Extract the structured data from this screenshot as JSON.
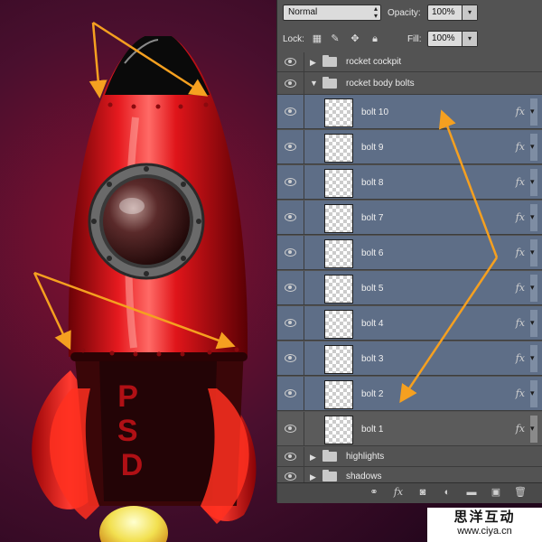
{
  "panel": {
    "blend_mode": "Normal",
    "opacity_label": "Opacity:",
    "opacity_value": "100%",
    "lock_label": "Lock:",
    "fill_label": "Fill:",
    "fill_value": "100%"
  },
  "artwork": {
    "rocket_text": "PSD"
  },
  "groups": {
    "cockpit": "rocket cockpit",
    "body_bolts": "rocket body bolts",
    "highlights": "highlights",
    "shadows": "shadows"
  },
  "layers": [
    {
      "name": "bolt 10",
      "fx": "fx"
    },
    {
      "name": "bolt 9",
      "fx": "fx"
    },
    {
      "name": "bolt 8",
      "fx": "fx"
    },
    {
      "name": "bolt 7",
      "fx": "fx"
    },
    {
      "name": "bolt 6",
      "fx": "fx"
    },
    {
      "name": "bolt 5",
      "fx": "fx"
    },
    {
      "name": "bolt 4",
      "fx": "fx"
    },
    {
      "name": "bolt 3",
      "fx": "fx"
    },
    {
      "name": "bolt 2",
      "fx": "fx"
    },
    {
      "name": "bolt 1",
      "fx": "fx"
    }
  ],
  "footer_icons": [
    "link-icon",
    "fx-icon",
    "mask-icon",
    "adjustment-icon",
    "folder-icon",
    "new-layer-icon",
    "trash-icon"
  ],
  "footer_fx": "fx",
  "watermark": {
    "cn": "思洋互动",
    "url": "www.ciya.cn"
  },
  "colors": {
    "arrow": "#f5a020",
    "selected_layer": "#5e6e87",
    "rocket_red": "#e8141a"
  }
}
